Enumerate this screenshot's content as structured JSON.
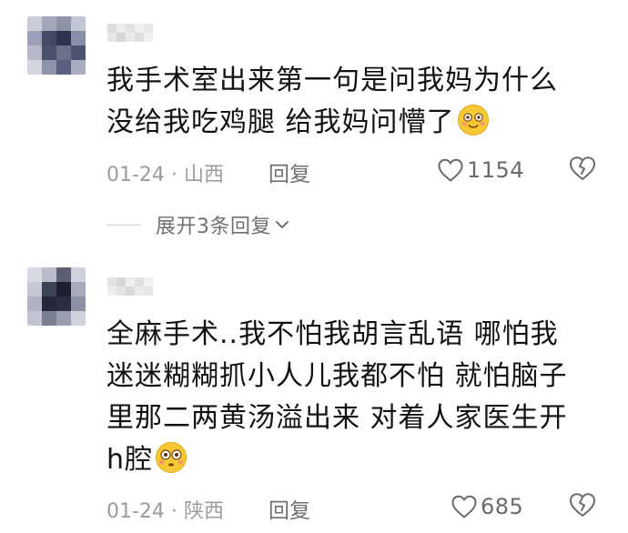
{
  "comments": [
    {
      "text_lines": [
        "我手术室出来第一句是问我妈为什么",
        "没给我吃鸡腿 给我妈问懵了"
      ],
      "trailing_emoji": "smiling-blush-emoji",
      "date": "01-24",
      "location": "山西",
      "separator": "·",
      "reply_label": "回复",
      "like_count": "1154",
      "expand_label": "展开3条回复"
    },
    {
      "text_lines": [
        "全麻手术..我不怕我胡言乱语 哪怕我",
        "迷迷糊糊抓小人儿我都不怕 就怕脑子",
        "里那二两黄汤溢出来 对着人家医生开",
        "h腔"
      ],
      "trailing_emoji": "flushed-face-emoji",
      "date": "01-24",
      "location": "陕西",
      "separator": "·",
      "reply_label": "回复",
      "like_count": "685"
    }
  ],
  "icons": {
    "like": "heart-outline-icon",
    "dislike": "broken-heart-icon",
    "expand": "chevron-down-icon"
  },
  "colors": {
    "text_primary": "#111111",
    "text_meta": "#9b9b9b",
    "emoji_yellow": "#f7c934"
  }
}
